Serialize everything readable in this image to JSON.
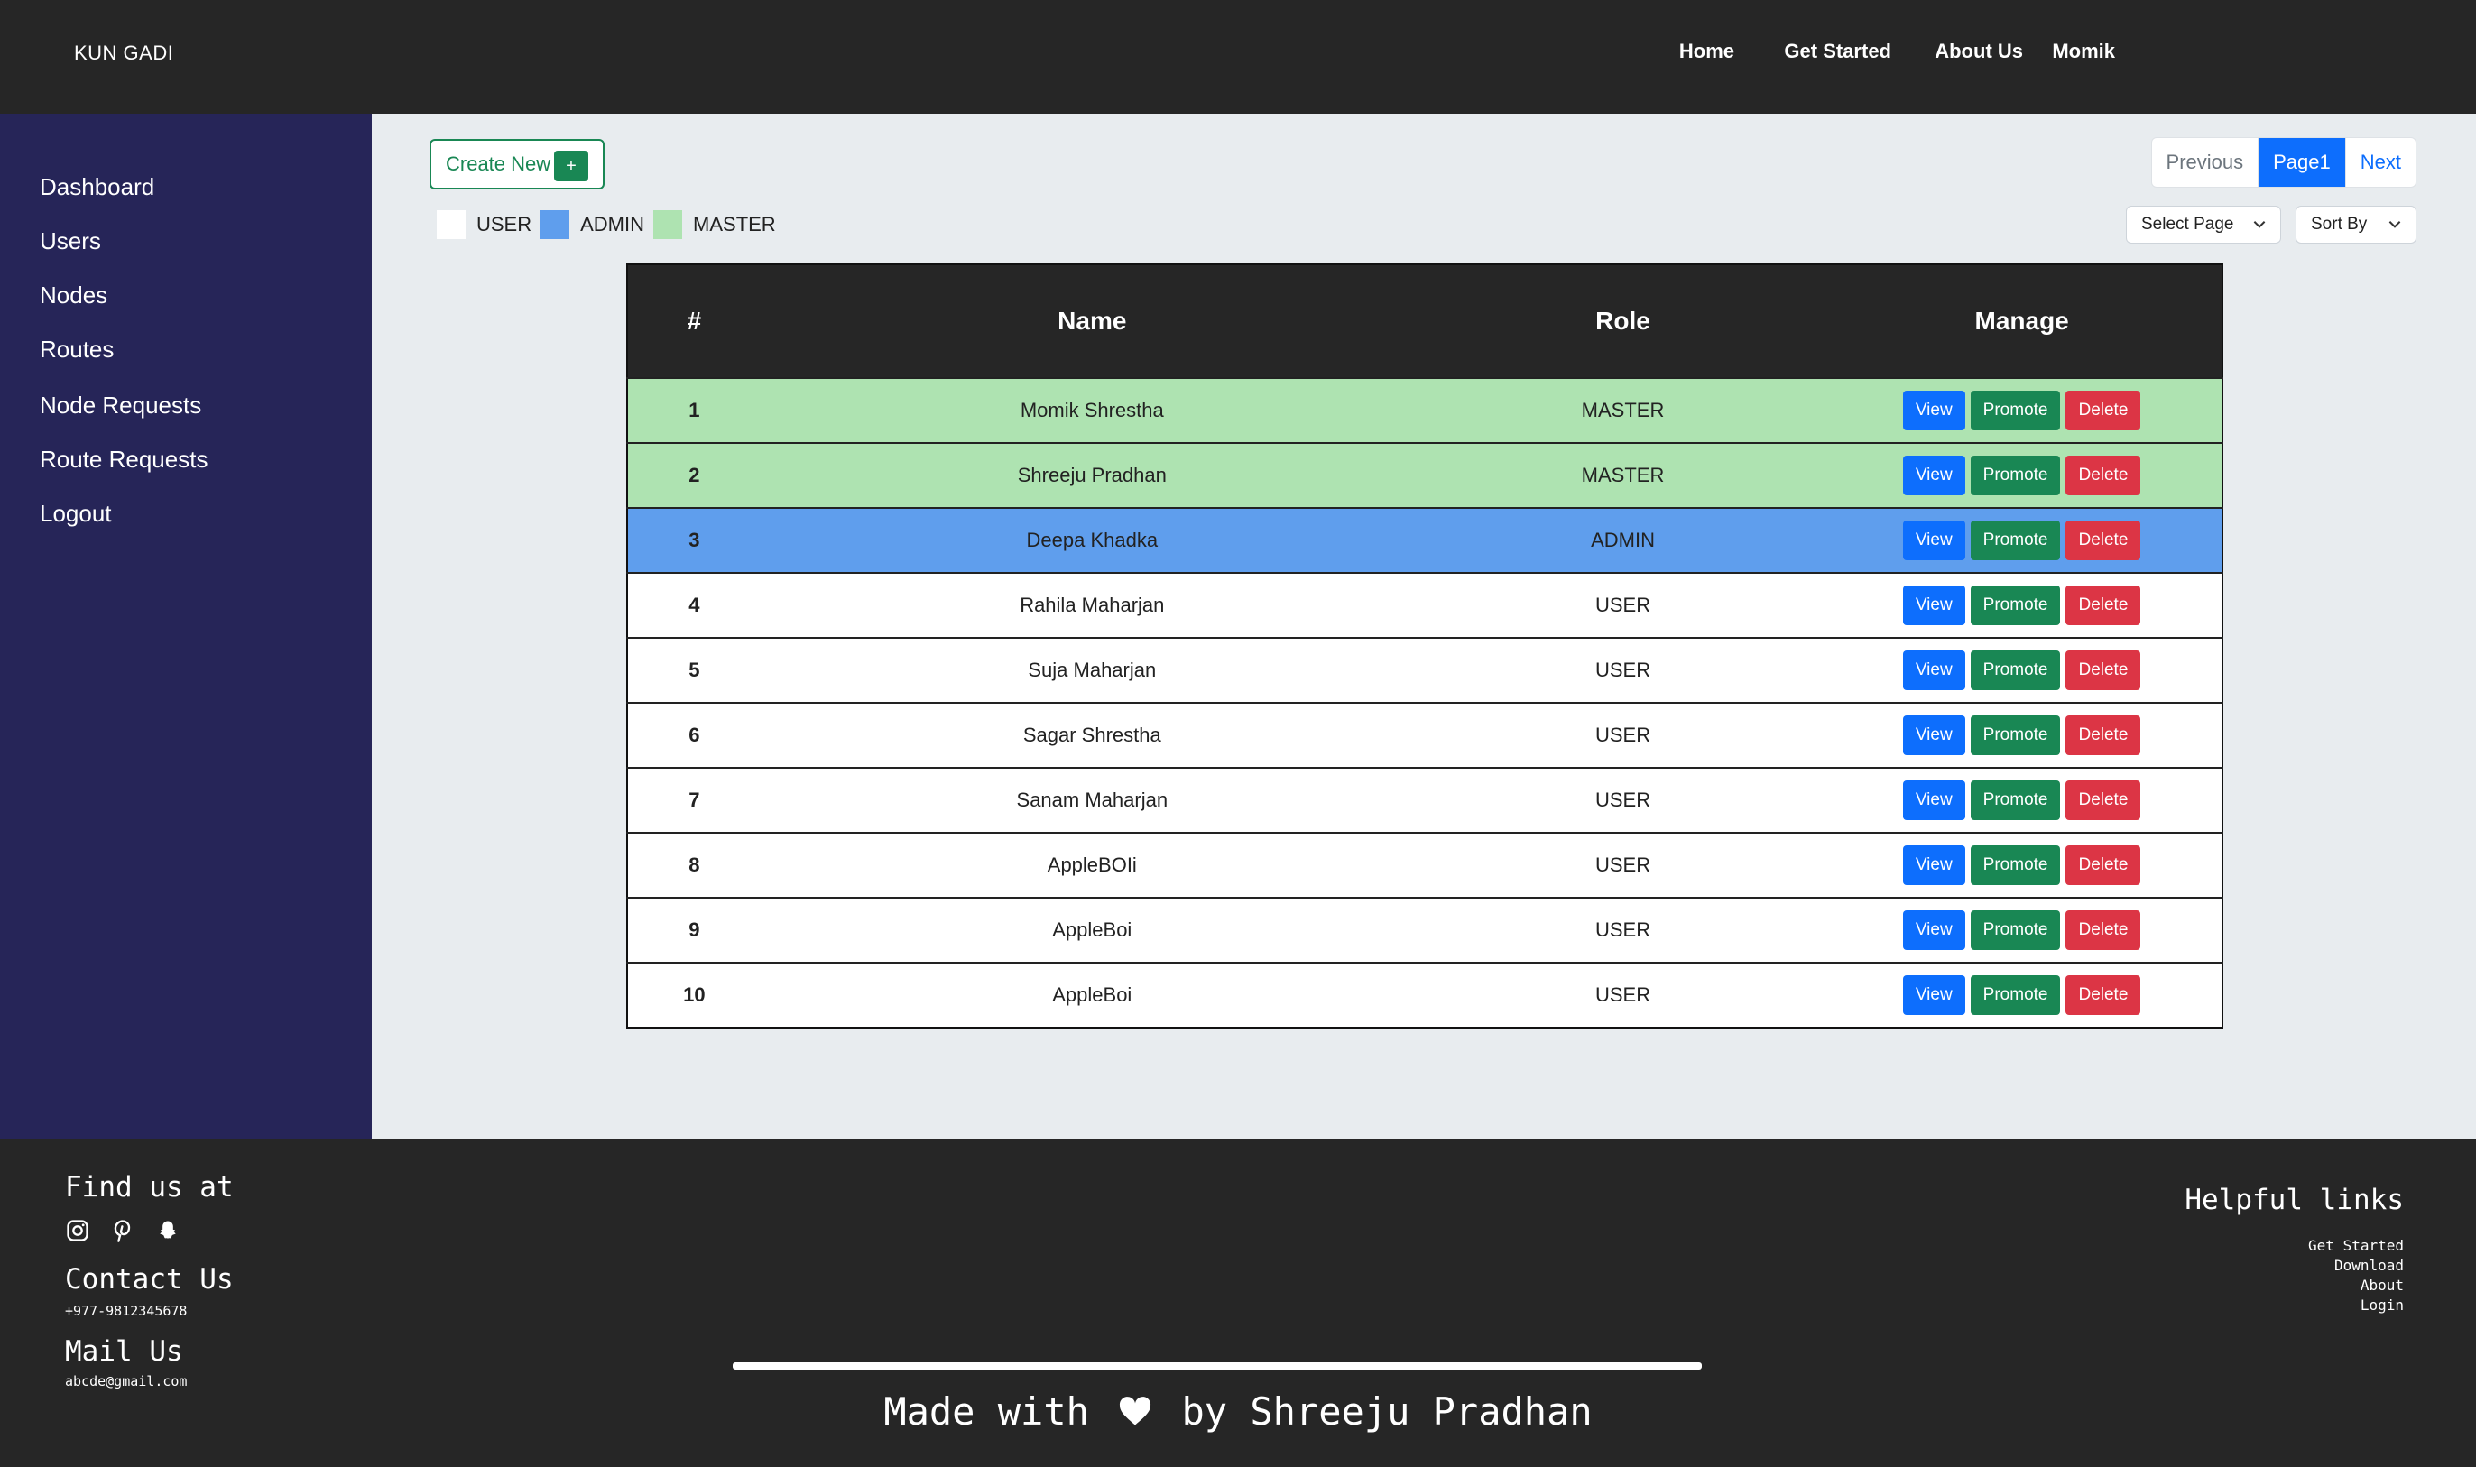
{
  "navbar": {
    "brand": "KUN GADI",
    "links": [
      "Home",
      "Get Started",
      "About Us",
      "Momik"
    ]
  },
  "sidebar": {
    "items": [
      "Dashboard",
      "Users",
      "Nodes",
      "Routes",
      "Node Requests",
      "Route Requests",
      "Logout"
    ]
  },
  "toolbar": {
    "create_label": "Create New",
    "create_icon": "+",
    "legend": [
      {
        "label": "USER",
        "color": "#ffffff"
      },
      {
        "label": "ADMIN",
        "color": "#5f9eed"
      },
      {
        "label": "MASTER",
        "color": "#aee3b1"
      }
    ],
    "pager": {
      "previous": "Previous",
      "current": "Page1",
      "next": "Next"
    },
    "select_page": "Select Page",
    "sort_by": "Sort By"
  },
  "table": {
    "headers": [
      "#",
      "Name",
      "Role",
      "Manage"
    ],
    "actions": {
      "view": "View",
      "promote": "Promote",
      "delete": "Delete"
    },
    "rows": [
      {
        "num": "1",
        "name": "Momik Shrestha",
        "role": "MASTER"
      },
      {
        "num": "2",
        "name": "Shreeju Pradhan",
        "role": "MASTER"
      },
      {
        "num": "3",
        "name": "Deepa Khadka",
        "role": "ADMIN"
      },
      {
        "num": "4",
        "name": "Rahila Maharjan",
        "role": "USER"
      },
      {
        "num": "5",
        "name": "Suja Maharjan",
        "role": "USER"
      },
      {
        "num": "6",
        "name": "Sagar Shrestha",
        "role": "USER"
      },
      {
        "num": "7",
        "name": "Sanam Maharjan",
        "role": "USER"
      },
      {
        "num": "8",
        "name": "AppleBOIi",
        "role": "USER"
      },
      {
        "num": "9",
        "name": "AppleBoi",
        "role": "USER"
      },
      {
        "num": "10",
        "name": "AppleBoi",
        "role": "USER"
      }
    ]
  },
  "footer": {
    "find_us": "Find us at",
    "social_icons": [
      "instagram-icon",
      "pinterest-icon",
      "snapchat-icon"
    ],
    "contact_title": "Contact Us",
    "contact_phone": "+977-9812345678",
    "mail_title": "Mail Us",
    "mail_address": "abcde@gmail.com",
    "helpful_title": "Helpful links",
    "helpful_links": [
      "Get Started",
      "Download",
      "About",
      "Login"
    ],
    "made_prefix": "Made with",
    "made_suffix": "by Shreeju Pradhan"
  }
}
